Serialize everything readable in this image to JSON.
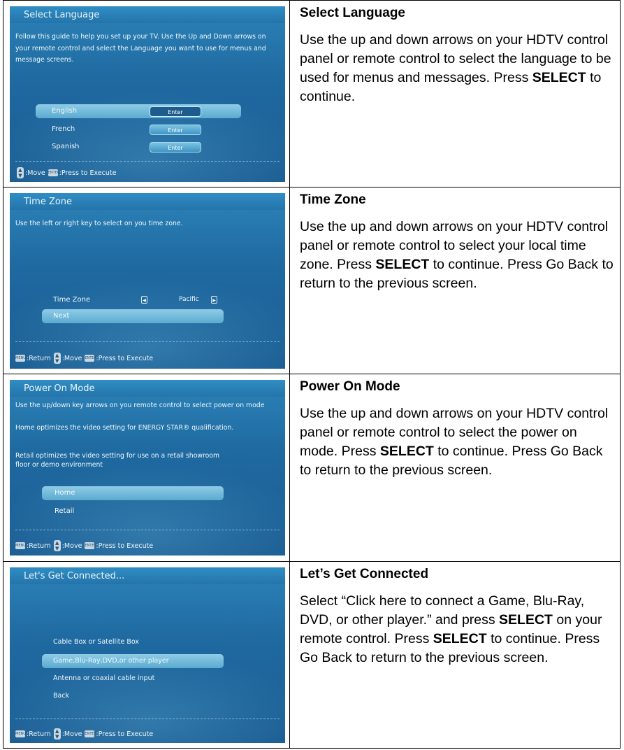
{
  "screen1": {
    "title": "Select Language",
    "text": "Follow this guide to help you set up your TV. Use the Up and Down arrows on your remote control and select the Language you want to use for menus and message screens.",
    "options": [
      {
        "label": "English",
        "button": "Enter"
      },
      {
        "label": "French",
        "button": "Enter"
      },
      {
        "label": "Spanish",
        "button": "Enter"
      }
    ],
    "footer": {
      "move": ":Move",
      "execute": ":Press to Execute"
    },
    "key_enter": "ENTER"
  },
  "screen2": {
    "title": "Time Zone",
    "text": "Use the left or right key to select on you time zone.",
    "row_label": "Time Zone",
    "row_value": "Pacific",
    "next": "Next",
    "footer": {
      "return": ":Return",
      "move": ":Move",
      "execute": ":Press to Execute"
    },
    "key_menu": "MENU",
    "key_enter": "ENTER"
  },
  "screen3": {
    "title": "Power On Mode",
    "text1": "Use the up/down key arrows on you remote control to select power on mode",
    "text2": "Home optimizes the video setting for ENERGY STAR® qualification.",
    "text3": "Retail optimizes the video setting for use on a retail showroom floor or demo environment",
    "options": [
      "Home",
      "Retail"
    ],
    "footer": {
      "return": ":Return",
      "move": ":Move",
      "execute": ":Press to Execute"
    },
    "key_menu": "MENU",
    "key_enter": "ENTER"
  },
  "screen4": {
    "title": "Let's Get Connected...",
    "options": [
      "Cable Box or Satellite Box",
      "Game,Blu-Ray,DVD,or other player",
      "Antenna or coaxial cable input",
      "Back"
    ],
    "footer": {
      "return": ":Return",
      "move": ":Move",
      "execute": ":Press to Execute"
    },
    "key_menu": "MENU",
    "key_enter": "ENTER"
  },
  "right": {
    "r1": {
      "heading": "Select Language",
      "p_a": "Use the up and down arrows on your HDTV control panel or remote control to select the language to be used for menus and messages. Press ",
      "p_b": "SELECT",
      "p_c": " to continue."
    },
    "r2": {
      "heading": "Time Zone",
      "p_a": "Use the up and down arrows on your HDTV control panel or remote control to select your local time zone. Press ",
      "p_b": "SELECT",
      "p_c": " to continue. Press Go Back to return to the previous screen."
    },
    "r3": {
      "heading": "Power On Mode",
      "p_a": "Use the up and down arrows on your HDTV control panel or remote control to select the power on mode. Press ",
      "p_b": "SELECT",
      "p_c": " to continue. Press Go Back to return to the previous screen."
    },
    "r4": {
      "heading": "Let’s Get Connected",
      "p_a": "Select “Click here to connect a Game, Blu-Ray, DVD, or other player.” and press ",
      "p_b": "SELECT",
      "p_c": " on your remote control. Press ",
      "p_d": "SELECT",
      "p_e": " to continue. Press Go Back to return to the previous screen."
    }
  }
}
